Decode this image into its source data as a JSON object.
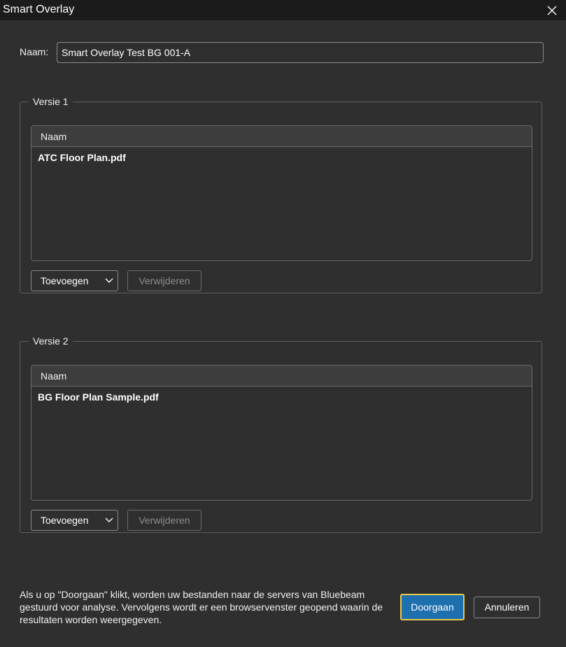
{
  "window": {
    "title": "Smart Overlay",
    "close_icon": "close-icon"
  },
  "name_field": {
    "label": "Naam:",
    "value": "Smart Overlay Test BG 001-A"
  },
  "version1": {
    "legend": "Versie 1",
    "column_header": "Naam",
    "files": [
      "ATC Floor Plan.pdf"
    ],
    "add_label": "Toevoegen",
    "remove_label": "Verwijderen"
  },
  "version2": {
    "legend": "Versie 2",
    "column_header": "Naam",
    "files": [
      "BG Floor Plan Sample.pdf"
    ],
    "add_label": "Toevoegen",
    "remove_label": "Verwijderen"
  },
  "footer": {
    "notice": "Als u op \"Doorgaan\" klikt, worden uw bestanden naar de servers van Bluebeam gestuurd voor analyse. Vervolgens wordt er een browservenster geopend waarin de resultaten worden weergegeven.",
    "continue_label": "Doorgaan",
    "cancel_label": "Annuleren"
  },
  "colors": {
    "background": "#2f2f2f",
    "titlebar": "#1b1b1b",
    "primary": "#1d6fae",
    "focus_ring": "#e8c84a"
  }
}
